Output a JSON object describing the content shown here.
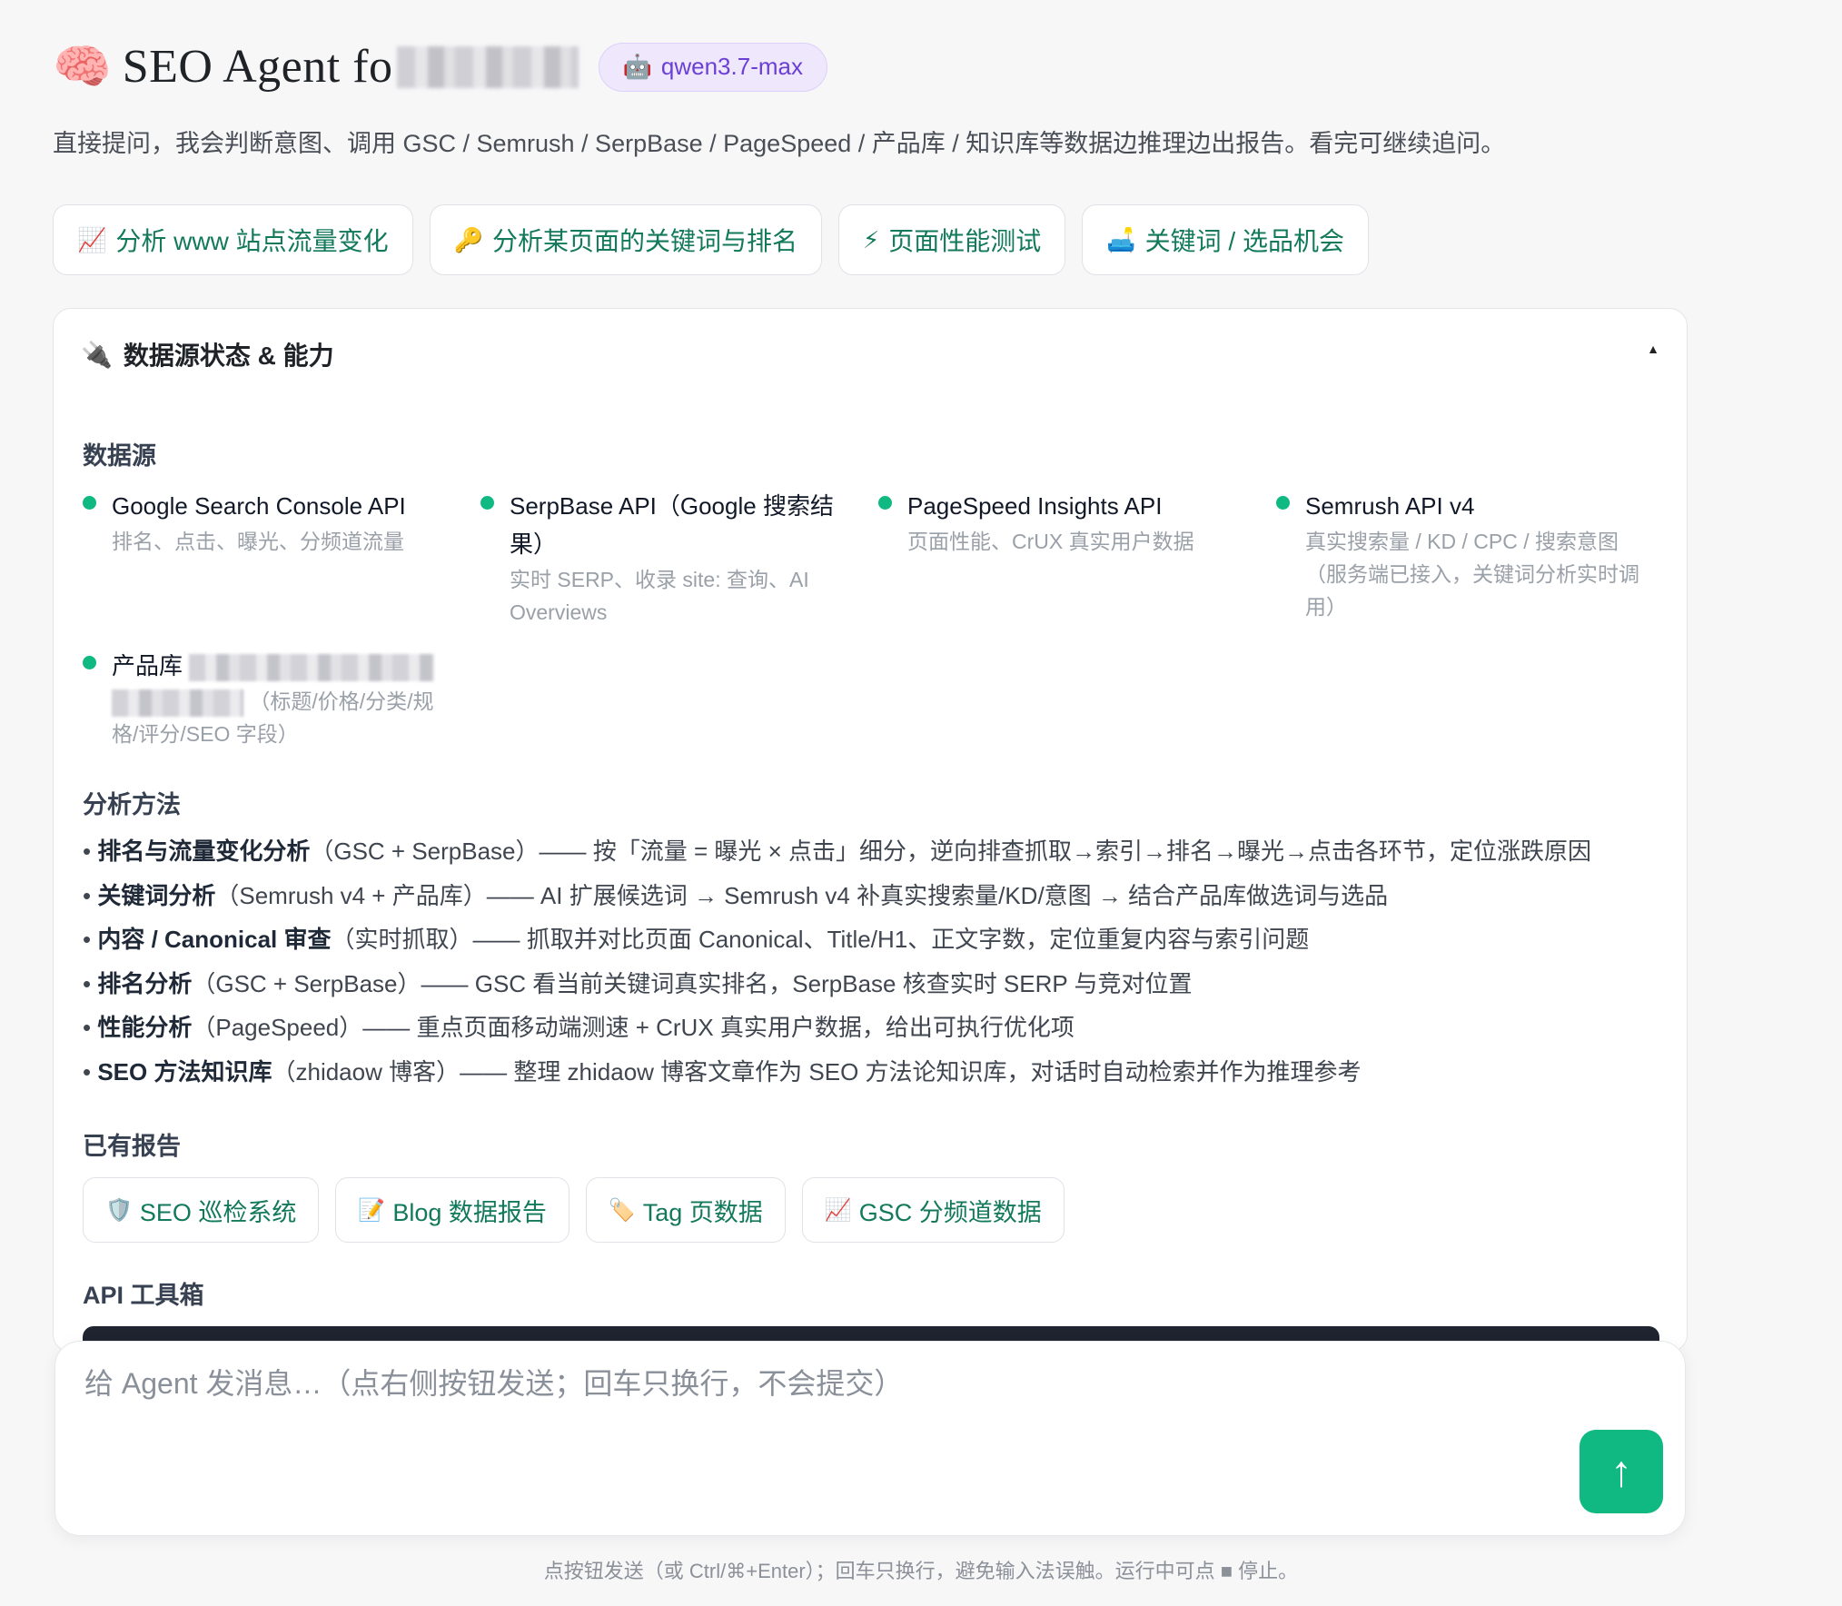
{
  "app": {
    "brain_icon": "🧠",
    "title": "SEO Agent fo",
    "model_icon": "🤖",
    "model": "qwen3.7-max",
    "subtitle": "直接提问，我会判断意图、调用 GSC / Semrush / SerpBase / PageSpeed / 产品库 / 知识库等数据边推理边出报告。看完可继续追问。"
  },
  "quick_actions": [
    {
      "icon": "📈",
      "label": "分析 www 站点流量变化"
    },
    {
      "icon": "🔑",
      "label": "分析某页面的关键词与排名"
    },
    {
      "icon": "⚡",
      "label": "页面性能测试"
    },
    {
      "icon": "🛋️",
      "label": "关键词 / 选品机会"
    }
  ],
  "panel": {
    "icon": "🔌",
    "title": "数据源状态 & 能力",
    "collapse_glyph": "▲",
    "sources_title": "数据源",
    "sources": [
      {
        "name": "Google Search Console API",
        "desc": "排名、点击、曝光、分频道流量",
        "status_color": "#10b981"
      },
      {
        "name": "SerpBase API（Google 搜索结果）",
        "desc": "实时 SERP、收录 site: 查询、AI Overviews",
        "status_color": "#10b981"
      },
      {
        "name": "PageSpeed Insights API",
        "desc": "页面性能、CrUX 真实用户数据",
        "status_color": "#10b981"
      },
      {
        "name": "Semrush API v4",
        "desc": "真实搜索量 / KD / CPC / 搜索意图（服务端已接入，关键词分析实时调用）",
        "status_color": "#10b981"
      },
      {
        "name": "产品库",
        "desc": "（标题/价格/分类/规格/评分/SEO 字段）",
        "status_color": "#10b981"
      }
    ],
    "methods_title": "分析方法",
    "methods": [
      {
        "bullet": "•",
        "name": "排名与流量变化分析",
        "detail": "（GSC + SerpBase）—— 按「流量 = 曝光 × 点击」细分，逆向排查抓取→索引→排名→曝光→点击各环节，定位涨跌原因"
      },
      {
        "bullet": "•",
        "name": "关键词分析",
        "detail": "（Semrush v4 + 产品库）—— AI 扩展候选词 → Semrush v4 补真实搜索量/KD/意图 → 结合产品库做选词与选品"
      },
      {
        "bullet": "•",
        "name": "内容 / Canonical 审查",
        "detail": "（实时抓取）—— 抓取并对比页面 Canonical、Title/H1、正文字数，定位重复内容与索引问题"
      },
      {
        "bullet": "•",
        "name": "排名分析",
        "detail": "（GSC + SerpBase）—— GSC 看当前关键词真实排名，SerpBase 核查实时 SERP 与竞对位置"
      },
      {
        "bullet": "•",
        "name": "性能分析",
        "detail": "（PageSpeed）—— 重点页面移动端测速 + CrUX 真实用户数据，给出可执行优化项"
      },
      {
        "bullet": "•",
        "name": "SEO 方法知识库",
        "detail": "（zhidaow 博客）—— 整理 zhidaow 博客文章作为 SEO 方法论知识库，对话时自动检索并作为推理参考"
      }
    ],
    "reports_title": "已有报告",
    "reports": [
      {
        "icon": "🛡️",
        "label": "SEO 巡检系统"
      },
      {
        "icon": "📝",
        "label": "Blog 数据报告"
      },
      {
        "icon": "🏷️",
        "label": "Tag 页数据"
      },
      {
        "icon": "📈",
        "label": "GSC 分频道数据"
      }
    ],
    "api_title": "API 工具箱"
  },
  "composer": {
    "placeholder": "给 Agent 发消息…（点右侧按钮发送；回车只换行，不会提交）",
    "send_glyph": "↑",
    "hint": "点按钮发送（或 Ctrl/⌘+Enter）；回车只换行，避免输入法误触。运行中可点 ■ 停止。"
  },
  "colors": {
    "accent": "#10b981",
    "link_green": "#13795b",
    "badge_purple": "#6b3fd6"
  }
}
